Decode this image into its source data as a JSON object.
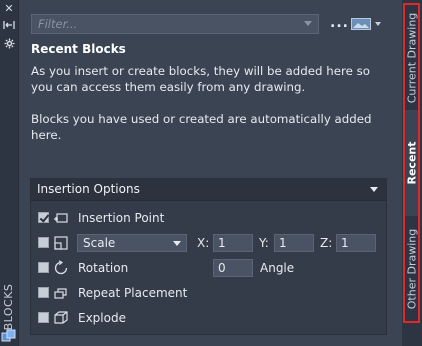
{
  "palette": {
    "title": "BLOCKS",
    "top_icons": [
      "close-icon",
      "autohide-pin-icon",
      "properties-gear-icon"
    ]
  },
  "toolbar": {
    "filter_placeholder": "Filter...",
    "more_label": "...",
    "view_icon": "thumbnail-view-icon"
  },
  "content": {
    "heading": "Recent Blocks",
    "description": "As you insert or create blocks, they will be added here so you can access them easily from any drawing.",
    "note": "Blocks you have used or created are automatically added here."
  },
  "insertion_options": {
    "title": "Insertion Options",
    "rows": {
      "insertion_point": {
        "label": "Insertion Point",
        "checked": true
      },
      "scale": {
        "checked": false,
        "mode": "Scale",
        "x_label": "X:",
        "x": "1",
        "y_label": "Y:",
        "y": "1",
        "z_label": "Z:",
        "z": "1"
      },
      "rotation": {
        "label": "Rotation",
        "checked": false,
        "angle": "0",
        "angle_label": "Angle"
      },
      "repeat_placement": {
        "label": "Repeat Placement",
        "checked": false
      },
      "explode": {
        "label": "Explode",
        "checked": false
      }
    }
  },
  "tabs": [
    {
      "label": "Current Drawing",
      "active": false
    },
    {
      "label": "Recent",
      "active": true
    },
    {
      "label": "Other Drawing",
      "active": false
    }
  ],
  "colors": {
    "highlight_outline": "#e0282b",
    "panel_bg": "#3b4453",
    "dark_bar": "#2e3542"
  }
}
